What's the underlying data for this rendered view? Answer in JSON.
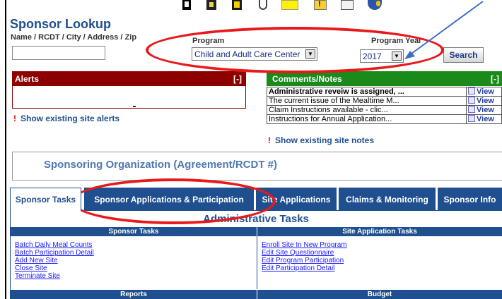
{
  "header": {
    "title": "Sponsor Lookup",
    "name_label": "Name / RCDT / City / Address / Zip",
    "name_value": "",
    "program_label": "Program",
    "program_value": "Child and Adult Care Center",
    "year_label": "Program Year",
    "year_value": "2017",
    "search_label": "Search"
  },
  "toolbar": {
    "icons": [
      "document-icon",
      "page-edit-icon",
      "warning-icon",
      "cup-icon",
      "folder-icon",
      "alert-icon",
      "list-icon",
      "globe-icon"
    ]
  },
  "alerts": {
    "title": "Alerts",
    "toggle": "[-]",
    "show_link": "Show existing site alerts",
    "marker": "!"
  },
  "comments": {
    "title": "Comments/Notes",
    "toggle": "[-]",
    "rows": [
      {
        "note": "Administrative reveiw is assigned, ...",
        "action": "View"
      },
      {
        "note": "The current issue of the Mealtime M...",
        "action": "View"
      },
      {
        "note": "Claim Instructions available - clic...",
        "action": "View"
      },
      {
        "note": "Instructions for Annual Application...",
        "action": "View"
      }
    ],
    "show_link": "Show existing site notes",
    "marker": "!"
  },
  "org": {
    "title": "Sponsoring Organization (Agreement/RCDT #)"
  },
  "tabs": [
    {
      "label": "Sponsor Tasks",
      "active": true
    },
    {
      "label": "Sponsor Applications & Participation",
      "active": false
    },
    {
      "label": "Site Applications",
      "active": false
    },
    {
      "label": "Claims & Monitoring",
      "active": false
    },
    {
      "label": "Sponsor Info",
      "active": false
    }
  ],
  "admin": {
    "title": "Administrative Tasks",
    "left_section": {
      "title": "Sponsor Tasks",
      "links": [
        "Batch Daily Meal Counts",
        "Batch Participation Detail",
        "Add New Site",
        "Close Site",
        "Terminate Site"
      ]
    },
    "right_section": {
      "title": "Site Application Tasks",
      "links": [
        "Enroll Site In New Program",
        "Edit Site Questionnaire",
        "Edit Program Participation",
        "Edit Participation Detail"
      ]
    },
    "bottom_left": "Reports",
    "bottom_right": "Budget"
  },
  "colors": {
    "brand_blue": "#1f4f8f",
    "alerts_red": "#8c0000",
    "notes_green": "#1a8a1a",
    "annotation_red": "#e8191b",
    "annotation_arrow": "#3a6fc4"
  }
}
